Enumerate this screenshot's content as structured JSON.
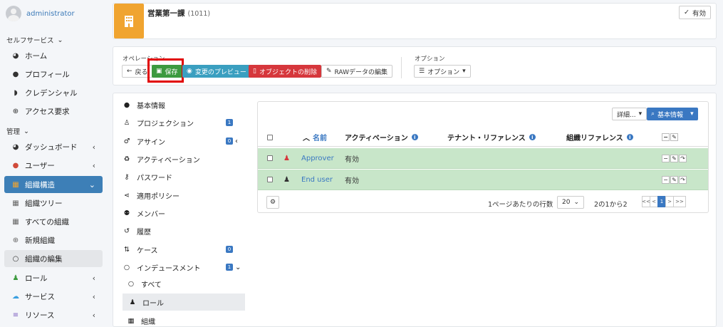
{
  "user": {
    "name": "administrator"
  },
  "sidebar": {
    "self_service_header": "セルフサービス",
    "self_service": [
      {
        "label": "ホーム",
        "icon": "dashboard-icon"
      },
      {
        "label": "プロフィール",
        "icon": "user-icon"
      },
      {
        "label": "クレデンシャル",
        "icon": "shield-icon"
      },
      {
        "label": "アクセス要求",
        "icon": "plus-circle-icon"
      }
    ],
    "admin_header": "管理",
    "admin": [
      {
        "label": "ダッシュボード"
      },
      {
        "label": "ユーザー"
      },
      {
        "label": "組織構造"
      },
      {
        "label": "組織ツリー"
      },
      {
        "label": "すべての組織"
      },
      {
        "label": "新規組織"
      },
      {
        "label": "組織の編集"
      },
      {
        "label": "ロール"
      },
      {
        "label": "サービス"
      },
      {
        "label": "リソース"
      }
    ]
  },
  "header": {
    "title": "営業第一課",
    "id": "(1011)",
    "status": "有効"
  },
  "operations": {
    "label": "オペレーション",
    "back": "戻る",
    "save": "保存",
    "preview": "変更のプレビュー",
    "delete": "オブジェクトの削除",
    "raw": "RAWデータの編集",
    "options_label": "オプション",
    "options": "オプション"
  },
  "tabs": [
    {
      "label": "基本情報"
    },
    {
      "label": "プロジェクション",
      "badge": "1"
    },
    {
      "label": "アサイン",
      "badge": "0"
    },
    {
      "label": "アクティベーション"
    },
    {
      "label": "パスワード"
    },
    {
      "label": "適用ポリシー"
    },
    {
      "label": "メンバー"
    },
    {
      "label": "履歴"
    },
    {
      "label": "ケース",
      "badge": "0"
    },
    {
      "label": "インデュースメント",
      "badge": "1"
    },
    {
      "label": "すべて"
    },
    {
      "label": "ロール"
    },
    {
      "label": "組織"
    }
  ],
  "toolbar": {
    "detail": "詳細...",
    "search": "基本情報"
  },
  "table": {
    "columns": [
      "名前",
      "アクティベーション",
      "テナント・リファレンス",
      "組織リファレンス"
    ],
    "rows": [
      {
        "name": "Approver",
        "activation": "有効"
      },
      {
        "name": "End user",
        "activation": "有効"
      }
    ]
  },
  "footer": {
    "rows_per_page_label": "1ページあたりの行数",
    "rows_per_page": "20",
    "range": "2の1から2",
    "pages": [
      "<<",
      "<",
      "1",
      ">",
      ">>"
    ]
  }
}
